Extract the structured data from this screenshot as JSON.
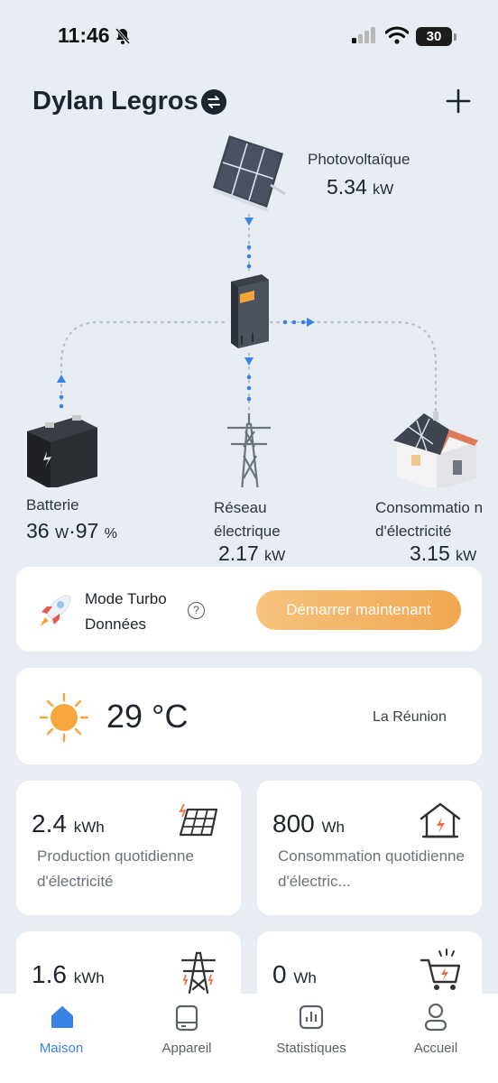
{
  "status_bar": {
    "time": "11:46",
    "battery": "30"
  },
  "header": {
    "account_name": "Dylan Legros"
  },
  "diagram": {
    "photovoltaic": {
      "label": "Photovoltaïque",
      "value": "5.34",
      "unit": "kW"
    },
    "battery": {
      "label": "Batterie",
      "power": "36",
      "power_unit": "W",
      "separator": "·",
      "soc": "97",
      "soc_unit": "%"
    },
    "grid": {
      "label": "Réseau électrique",
      "value": "2.17",
      "unit": "kW"
    },
    "consumption": {
      "label": "Consommatio n d'électricité",
      "value": "3.15",
      "unit": "kW"
    }
  },
  "turbo": {
    "title": "Mode Turbo Données",
    "help": "?",
    "button_label": "Démarrer maintenant"
  },
  "weather": {
    "temperature": "29 °C",
    "location": "La Réunion"
  },
  "stats": [
    {
      "value": "2.4",
      "unit": "kWh",
      "description": "Production quotidienne d'électricité",
      "icon": "solar-panel-icon"
    },
    {
      "value": "800",
      "unit": "Wh",
      "description": "Consommation quotidienne d'électric...",
      "icon": "house-icon"
    },
    {
      "value": "1.6",
      "unit": "kWh",
      "description": "",
      "icon": "power-tower-icon"
    },
    {
      "value": "0",
      "unit": "Wh",
      "description": "",
      "icon": "cart-icon"
    }
  ],
  "tabs": [
    {
      "label": "Maison",
      "icon": "home-icon",
      "active": true
    },
    {
      "label": "Appareil",
      "icon": "device-icon",
      "active": false
    },
    {
      "label": "Statistiques",
      "icon": "chart-icon",
      "active": false
    },
    {
      "label": "Accueil",
      "icon": "user-icon",
      "active": false
    }
  ],
  "colors": {
    "accent": "#3b82e6",
    "turbo_button": "#f0a850",
    "background": "#e8ecf3"
  }
}
